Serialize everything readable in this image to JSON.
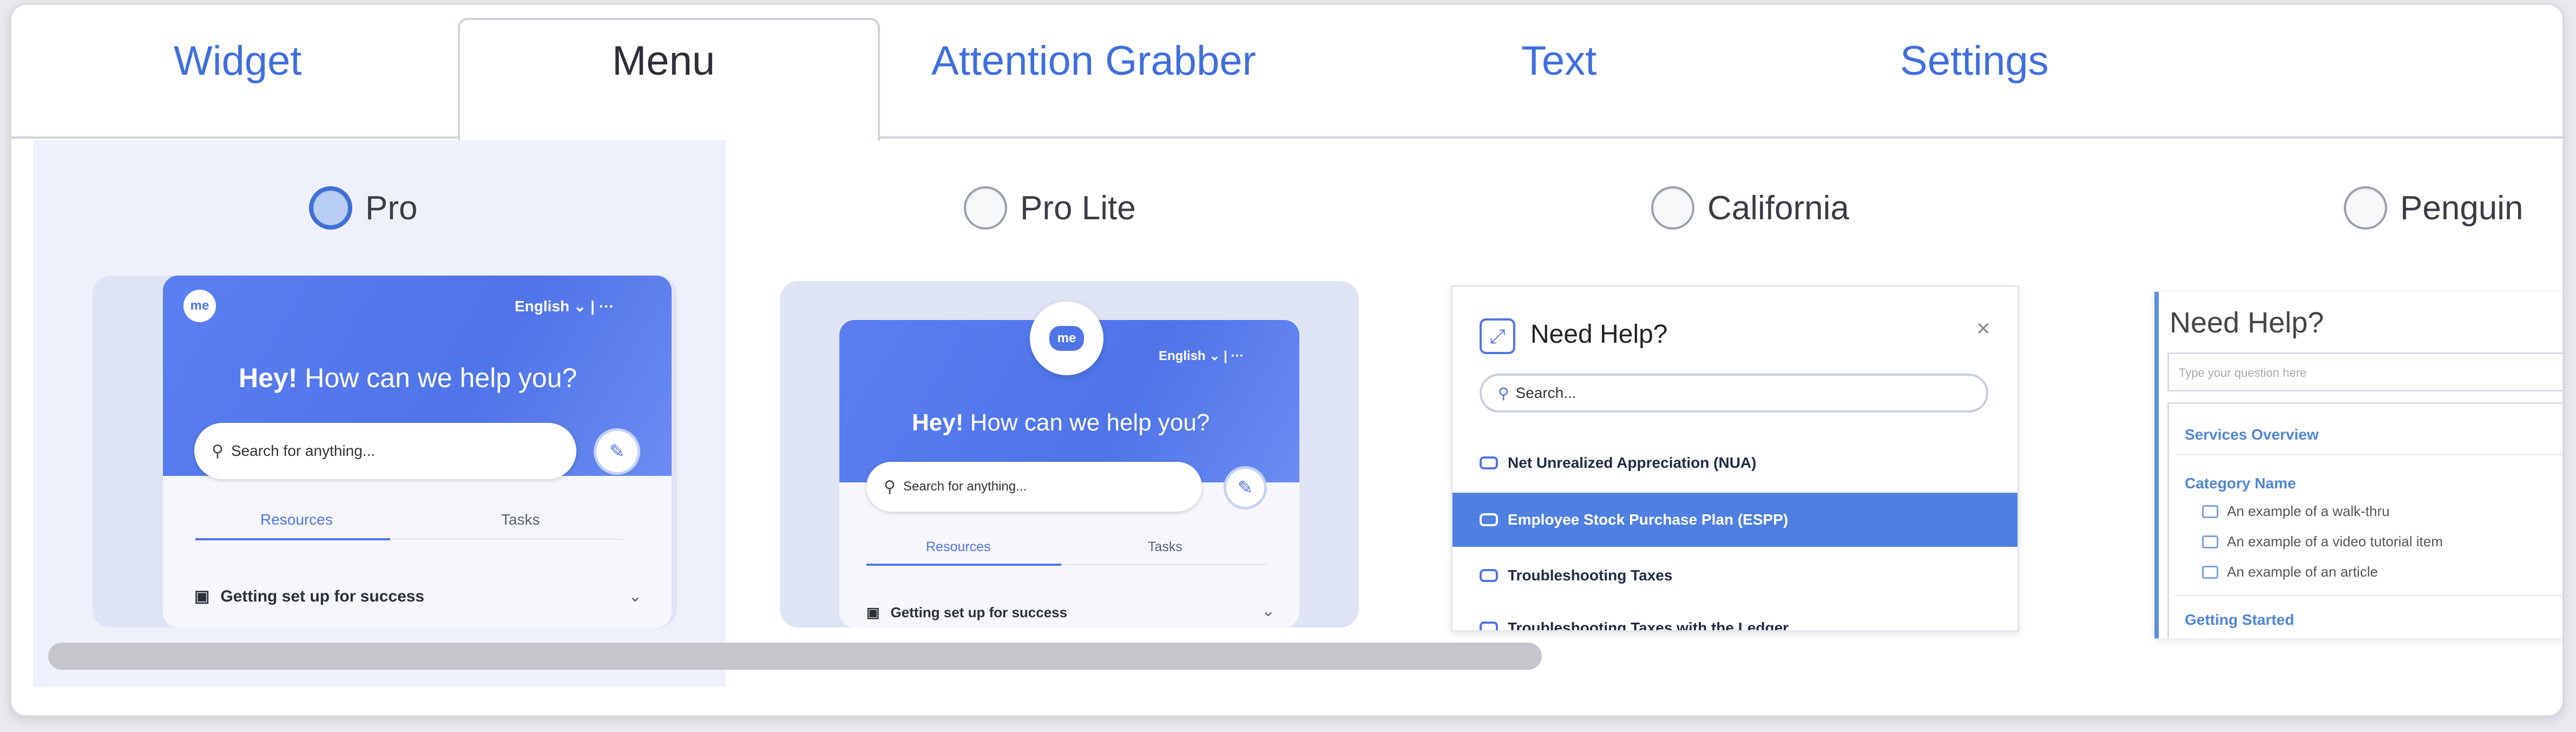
{
  "tabs": [
    {
      "label": "Widget"
    },
    {
      "label": "Menu"
    },
    {
      "label": "Attention Grabber"
    },
    {
      "label": "Text"
    },
    {
      "label": "Settings"
    }
  ],
  "active_tab": "Menu",
  "options": [
    {
      "label": "Pro",
      "selected": true
    },
    {
      "label": "Pro Lite",
      "selected": false
    },
    {
      "label": "California",
      "selected": false
    },
    {
      "label": "Penguin",
      "selected": false
    }
  ],
  "pro": {
    "logo": "me",
    "lang": "English ⌄  |  ···",
    "greeting_bold": "Hey!",
    "greeting_rest": " How can we help you?",
    "search_placeholder": "Search for anything...",
    "tab_resources": "Resources",
    "tab_tasks": "Tasks",
    "item": "Getting set up for success"
  },
  "prolite": {
    "logo": "me",
    "lang": "English ⌄  |  ···",
    "greeting_bold": "Hey!",
    "greeting_rest": " How can we help you?",
    "search_placeholder": "Search for anything...",
    "tab_resources": "Resources",
    "tab_tasks": "Tasks",
    "item": "Getting set up for success"
  },
  "california": {
    "title": "Need Help?",
    "search_placeholder": "Search...",
    "rows": [
      "Net Unrealized Appreciation (NUA)",
      "Employee Stock Purchase Plan (ESPP)",
      "Troubleshooting Taxes",
      "Troubleshooting Taxes with the Ledger"
    ]
  },
  "penguin": {
    "title": "Need Help?",
    "search_placeholder": "Type your question here",
    "services": "Services Overview",
    "category": "Category Name",
    "subs": [
      "An example of a walk-thru",
      "An example of a video tutorial item",
      "An example of an article"
    ],
    "getting_started": "Getting Started"
  },
  "colors": {
    "accent": "#3f6fde",
    "header": "#4f74e8",
    "highlight": "#4f7fe0"
  }
}
